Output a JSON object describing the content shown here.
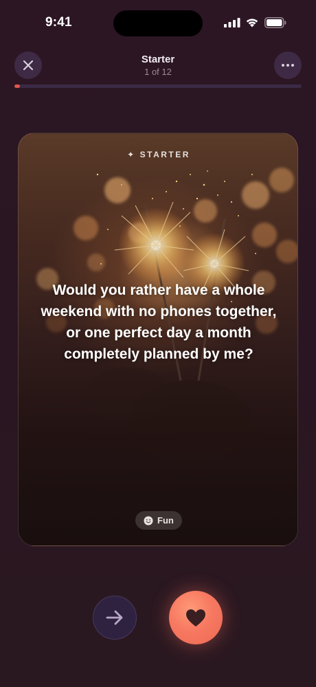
{
  "status_bar": {
    "time": "9:41"
  },
  "header": {
    "title": "Starter",
    "subtitle": "1 of 12",
    "progress": 0.02
  },
  "card": {
    "tag": "STARTER",
    "question": "Would you rather have a whole weekend with no phones together, or one perfect day a month completely planned by me?",
    "chip_label": "Fun"
  },
  "actions": {
    "skip_icon": "arrow-right-icon",
    "like_icon": "heart-icon"
  },
  "colors": {
    "background": "#2a1622",
    "progress_accent": "#e0574b",
    "like_button": "#f77961",
    "skip_button": "#2f2140"
  }
}
